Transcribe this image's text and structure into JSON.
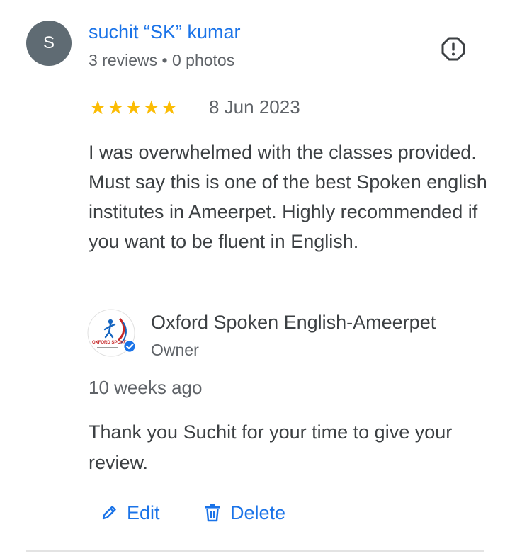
{
  "review": {
    "avatar_initial": "S",
    "reviewer_name": "suchit “SK” kumar",
    "reviewer_meta": "3 reviews • 0 photos",
    "rating": 5,
    "star_char": "★",
    "star_color": "#fbbc04",
    "date": "8 Jun 2023",
    "text": "I was overwhelmed with the classes provided. Must say this is one of the best Spoken english institutes in Ameerpet. Highly recommended if you want to be fluent in English."
  },
  "owner_reply": {
    "owner_name": "Oxford Spoken English-Ameerpet",
    "owner_role": "Owner",
    "logo_text": "OXFORD SPOKEN",
    "time_ago": "10 weeks ago",
    "text": "Thank you Suchit for your time to give your review."
  },
  "actions": {
    "edit_label": "Edit",
    "delete_label": "Delete"
  },
  "icons": {
    "report": "report-flag-icon",
    "edit": "pencil-icon",
    "delete": "trash-icon",
    "verified": "verified-check-icon"
  },
  "colors": {
    "link_blue": "#1a73e8",
    "avatar_bg": "#5f6b73",
    "verified_blue": "#1a73e8"
  }
}
